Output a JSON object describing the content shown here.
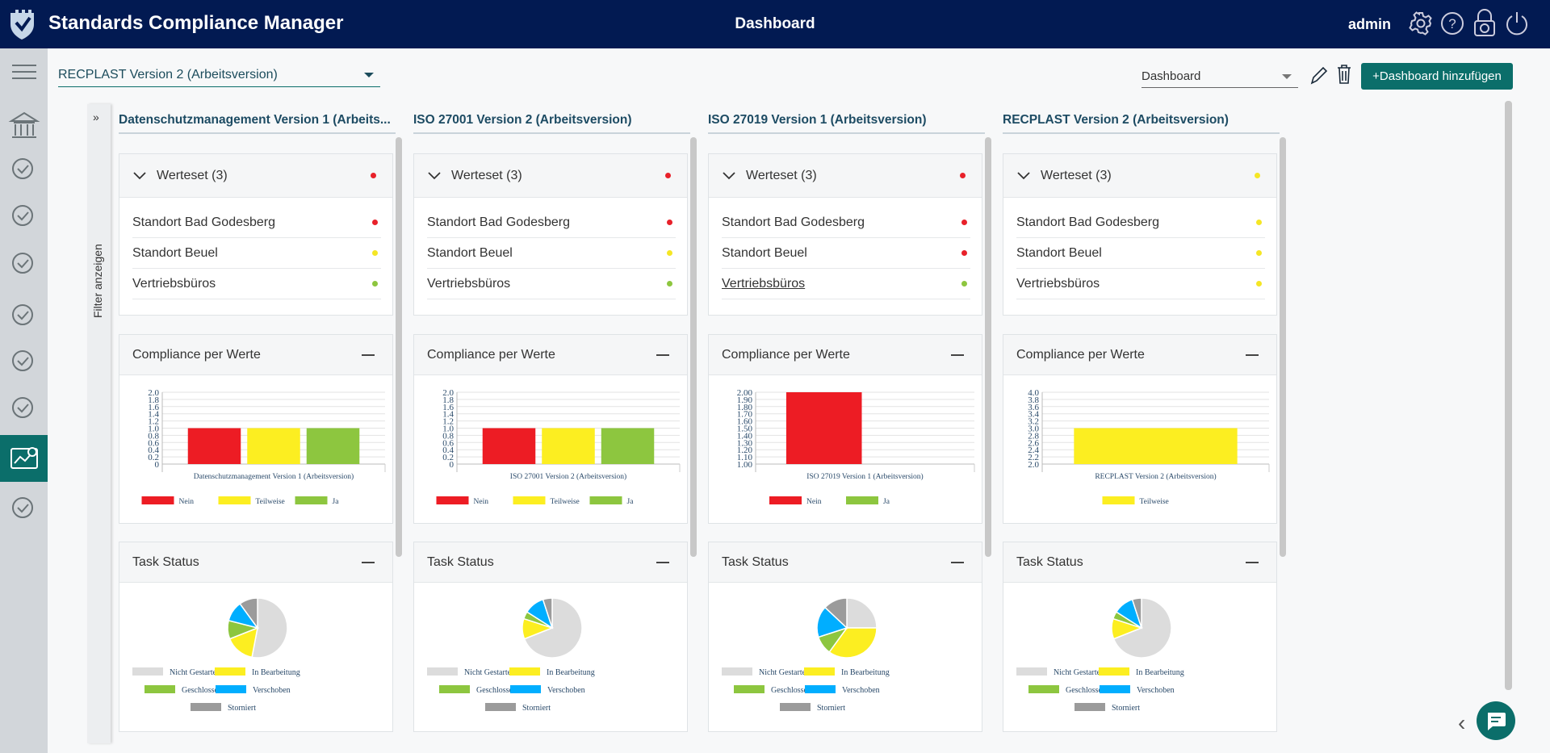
{
  "app": {
    "title": "Standards Compliance Manager",
    "page_title": "Dashboard",
    "user": "admin"
  },
  "header_icons": [
    "gear-icon",
    "help-icon",
    "lock-refresh-icon",
    "power-icon"
  ],
  "sidebar": {
    "items": [
      "menu-icon",
      "institution-icon",
      "roles-icon",
      "umbrella-shield-icon",
      "search-magnifier-icon",
      "shield-check-icon",
      "documents-icon",
      "edit-document-icon",
      "dashboard-chart-icon",
      "settings-list-icon"
    ],
    "active": 8
  },
  "toolbar": {
    "standard_select": "RECPLAST Version 2 (Arbeitsversion)",
    "dashboard_select": "Dashboard",
    "add_button": "+Dashboard hinzufügen",
    "edit_icon": "pencil-icon",
    "delete_icon": "trash-icon"
  },
  "filter": {
    "label": "Filter anzeigen"
  },
  "colors": {
    "primary": "#021a52",
    "accent": "#0b6e6a",
    "nein": "#ed1c24",
    "teilweise": "#fcee21",
    "ja": "#8dc63f",
    "nicht_gestartet": "#dcdcdc",
    "in_bearbeitung": "#fcee21",
    "geschlossen": "#8dc63f",
    "verschoben": "#00aeff",
    "storniert": "#9b9b9b"
  },
  "labels": {
    "werteset_title": "Werteset (3)",
    "compliance_title": "Compliance per Werte",
    "task_title": "Task Status"
  },
  "columns": [
    {
      "title": "Datenschutzmanagement Version 1 (Arbeits...",
      "werteset_status": "red",
      "rows": [
        {
          "name": "Standort Bad Godesberg",
          "status": "red"
        },
        {
          "name": "Standort Beuel",
          "status": "yellow"
        },
        {
          "name": "Vertriebsbüros",
          "status": "green"
        }
      ]
    },
    {
      "title": "ISO 27001 Version 2 (Arbeitsversion)",
      "werteset_status": "red",
      "rows": [
        {
          "name": "Standort Bad Godesberg",
          "status": "red"
        },
        {
          "name": "Standort Beuel",
          "status": "yellow"
        },
        {
          "name": "Vertriebsbüros",
          "status": "green"
        }
      ]
    },
    {
      "title": "ISO 27019 Version 1 (Arbeitsversion)",
      "werteset_status": "red",
      "rows": [
        {
          "name": "Standort Bad Godesberg",
          "status": "red"
        },
        {
          "name": "Standort Beuel",
          "status": "red"
        },
        {
          "name": "Vertriebsbüros",
          "status": "green",
          "hover": true
        }
      ]
    },
    {
      "title": "RECPLAST Version 2 (Arbeitsversion)",
      "werteset_status": "yellow",
      "rows": [
        {
          "name": "Standort Bad Godesberg",
          "status": "yellow"
        },
        {
          "name": "Standort Beuel",
          "status": "yellow"
        },
        {
          "name": "Vertriebsbüros",
          "status": "yellow"
        }
      ]
    }
  ],
  "chart_data": [
    {
      "type": "bar",
      "category": "Datenschutzmanagement Version 1 (Arbeitsversion)",
      "ylim": [
        0,
        2
      ],
      "ticks": [
        "0",
        "0.2",
        "0.4",
        "0.6",
        "0.8",
        "1.0",
        "1.2",
        "1.4",
        "1.6",
        "1.8",
        "2.0"
      ],
      "series": [
        {
          "name": "Nein",
          "value": 1,
          "color": "#ed1c24"
        },
        {
          "name": "Teilweise",
          "value": 1,
          "color": "#fcee21"
        },
        {
          "name": "Ja",
          "value": 1,
          "color": "#8dc63f"
        }
      ],
      "grid": true,
      "legend": "bottom"
    },
    {
      "type": "bar",
      "category": "ISO 27001 Version 2 (Arbeitsversion)",
      "ylim": [
        0,
        2
      ],
      "ticks": [
        "0",
        "0.2",
        "0.4",
        "0.6",
        "0.8",
        "1.0",
        "1.2",
        "1.4",
        "1.6",
        "1.8",
        "2.0"
      ],
      "series": [
        {
          "name": "Nein",
          "value": 1,
          "color": "#ed1c24"
        },
        {
          "name": "Teilweise",
          "value": 1,
          "color": "#fcee21"
        },
        {
          "name": "Ja",
          "value": 1,
          "color": "#8dc63f"
        }
      ],
      "grid": true,
      "legend": "bottom"
    },
    {
      "type": "bar",
      "category": "ISO 27019 Version 1 (Arbeitsversion)",
      "ylim": [
        1,
        2
      ],
      "ticks": [
        "1.00",
        "1.10",
        "1.20",
        "1.30",
        "1.40",
        "1.50",
        "1.60",
        "1.70",
        "1.80",
        "1.90",
        "2.00"
      ],
      "series": [
        {
          "name": "Nein",
          "value": 2,
          "color": "#ed1c24"
        },
        {
          "name": "Ja",
          "value": 1,
          "color": "#8dc63f"
        }
      ],
      "grid": true,
      "legend": "bottom"
    },
    {
      "type": "bar",
      "category": "RECPLAST Version 2 (Arbeitsversion)",
      "ylim": [
        2,
        4
      ],
      "ticks": [
        "2.0",
        "2.2",
        "2.4",
        "2.6",
        "2.8",
        "3.0",
        "3.2",
        "3.4",
        "3.6",
        "3.8",
        "4.0"
      ],
      "series": [
        {
          "name": "Teilweise",
          "value": 3,
          "color": "#fcee21"
        }
      ],
      "grid": true,
      "legend": "bottom"
    },
    {
      "type": "pie",
      "legend": "bottom",
      "categories": [
        "Nicht Gestartet",
        "In Bearbeitung",
        "Geschlossen",
        "Verschoben",
        "Storniert"
      ],
      "values": [
        53,
        16,
        10,
        11,
        10
      ]
    },
    {
      "type": "pie",
      "legend": "bottom",
      "categories": [
        "Nicht Gestartet",
        "In Bearbeitung",
        "Geschlossen",
        "Verschoben",
        "Storniert"
      ],
      "values": [
        69,
        11,
        4,
        11,
        5
      ]
    },
    {
      "type": "pie",
      "legend": "bottom",
      "categories": [
        "Nicht Gestartet",
        "In Bearbeitung",
        "Geschlossen",
        "Verschoben",
        "Storniert"
      ],
      "values": [
        25,
        35,
        10,
        17,
        13
      ]
    },
    {
      "type": "pie",
      "legend": "bottom",
      "categories": [
        "Nicht Gestartet",
        "In Bearbeitung",
        "Geschlossen",
        "Verschoben",
        "Storniert"
      ],
      "values": [
        69,
        11,
        4,
        11,
        5
      ]
    }
  ],
  "pie_colors": [
    "#dcdcdc",
    "#fcee21",
    "#8dc63f",
    "#00aeff",
    "#9b9b9b"
  ],
  "status_colors": {
    "red": "#e8212a",
    "yellow": "#f5e625",
    "green": "#8dc63f"
  }
}
